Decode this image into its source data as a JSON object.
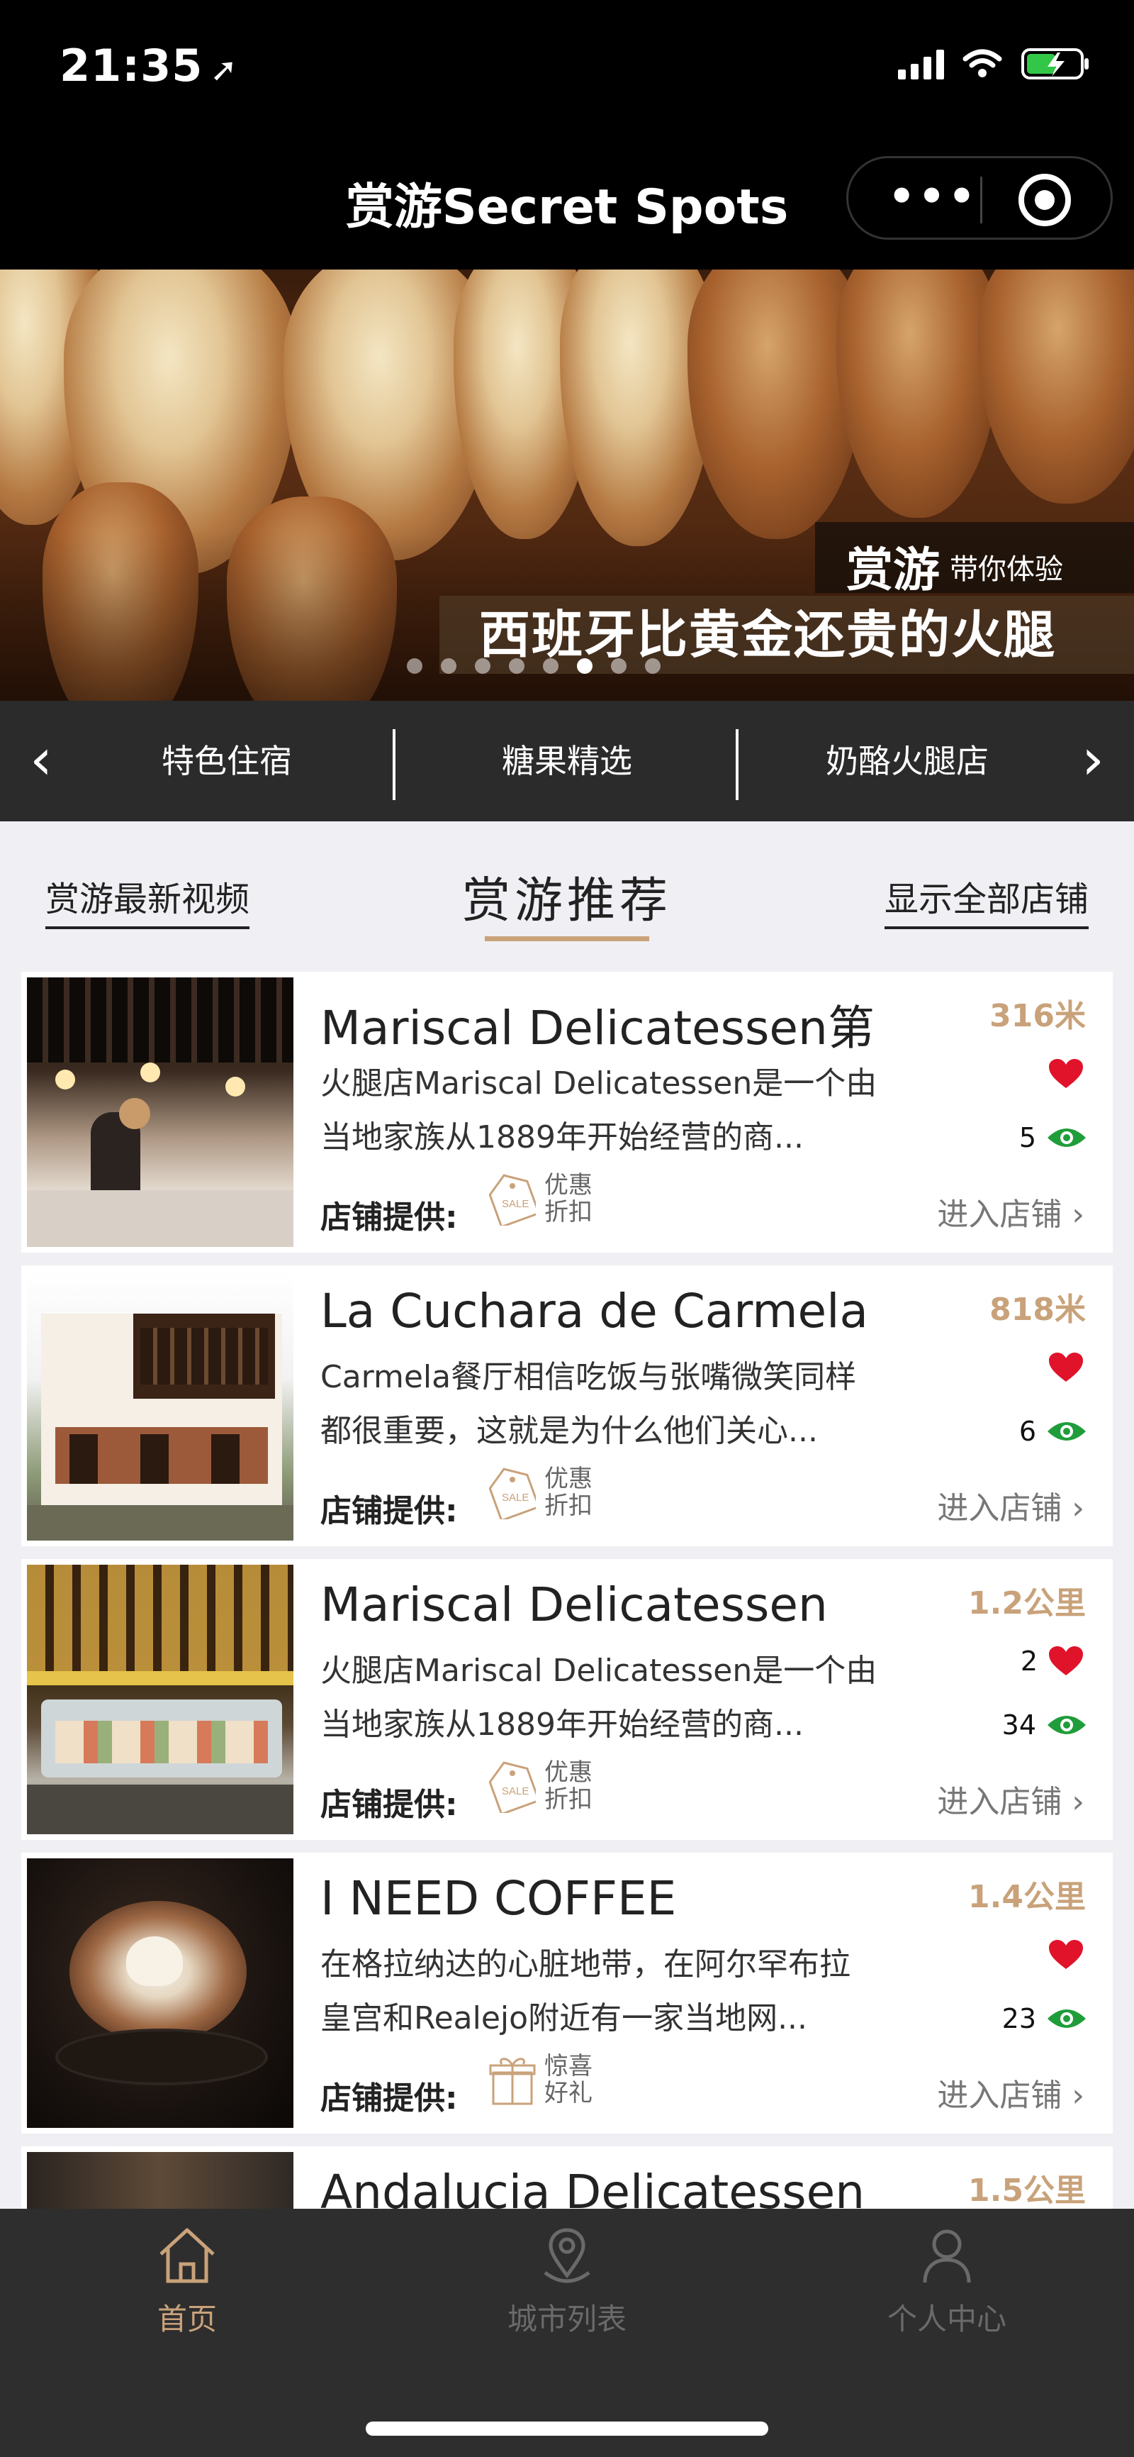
{
  "status_bar": {
    "time": "21:35",
    "location_icon": "location-arrow-icon",
    "signal_icon": "cellular-signal-icon",
    "wifi_icon": "wifi-icon",
    "battery_icon": "battery-charging-icon"
  },
  "nav": {
    "title": "赏游Secret Spots",
    "more_icon": "more-dots-icon",
    "close_icon": "target-circle-icon"
  },
  "banner": {
    "caption_big": "赏游",
    "caption_small": "带你体验",
    "headline": "西班牙比黄金还贵的火腿",
    "slides_total": 8,
    "active_slide": 6
  },
  "categories": {
    "items": [
      "特色住宿",
      "糖果精选",
      "奶酪火腿店"
    ],
    "prev_icon": "chevron-left-icon",
    "next_icon": "chevron-right-icon"
  },
  "tabs": {
    "left": "赏游最新视频",
    "center": "赏游推荐",
    "right": "显示全部店铺"
  },
  "colors": {
    "accent": "#c9a27a",
    "heart": "#e0132a",
    "eye": "#1f9d3a",
    "page_bg": "#f0f0f4",
    "tabbar_bg": "#2e2e2e"
  },
  "shops": [
    {
      "title": "Mariscal Delicatessen第",
      "desc_line1": "火腿店Mariscal Delicatessen是一个由",
      "desc_line2": "当地家族从1889年开始经营的商...",
      "distance": "316米",
      "likes": "",
      "views": "5",
      "provider_label": "店铺提供:",
      "tag_icon": "sale-tag-icon",
      "tag_line1": "优惠",
      "tag_line2": "折扣",
      "enter": "进入店铺"
    },
    {
      "title": "La Cuchara de Carmela",
      "desc_line1": "Carmela餐厅相信吃饭与张嘴微笑同样",
      "desc_line2": "都很重要，这就是为什么他们关心...",
      "distance": "818米",
      "likes": "",
      "views": "6",
      "provider_label": "店铺提供:",
      "tag_icon": "sale-tag-icon",
      "tag_line1": "优惠",
      "tag_line2": "折扣",
      "enter": "进入店铺"
    },
    {
      "title": "Mariscal Delicatessen",
      "desc_line1": "火腿店Mariscal Delicatessen是一个由",
      "desc_line2": "当地家族从1889年开始经营的商...",
      "distance": "1.2公里",
      "likes": "2",
      "views": "34",
      "provider_label": "店铺提供:",
      "tag_icon": "sale-tag-icon",
      "tag_line1": "优惠",
      "tag_line2": "折扣",
      "enter": "进入店铺"
    },
    {
      "title": "I NEED COFFEE",
      "desc_line1": "在格拉纳达的心脏地带，在阿尔罕布拉",
      "desc_line2": "皇宫和Realejo附近有一家当地网...",
      "distance": "1.4公里",
      "likes": "",
      "views": "23",
      "provider_label": "店铺提供:",
      "tag_icon": "gift-icon",
      "tag_line1": "惊喜",
      "tag_line2": "好礼",
      "enter": "进入店铺"
    },
    {
      "title": "Andalucia Delicatessen",
      "distance": "1.5公里"
    }
  ],
  "tabbar": {
    "home": "首页",
    "city": "城市列表",
    "profile": "个人中心"
  }
}
